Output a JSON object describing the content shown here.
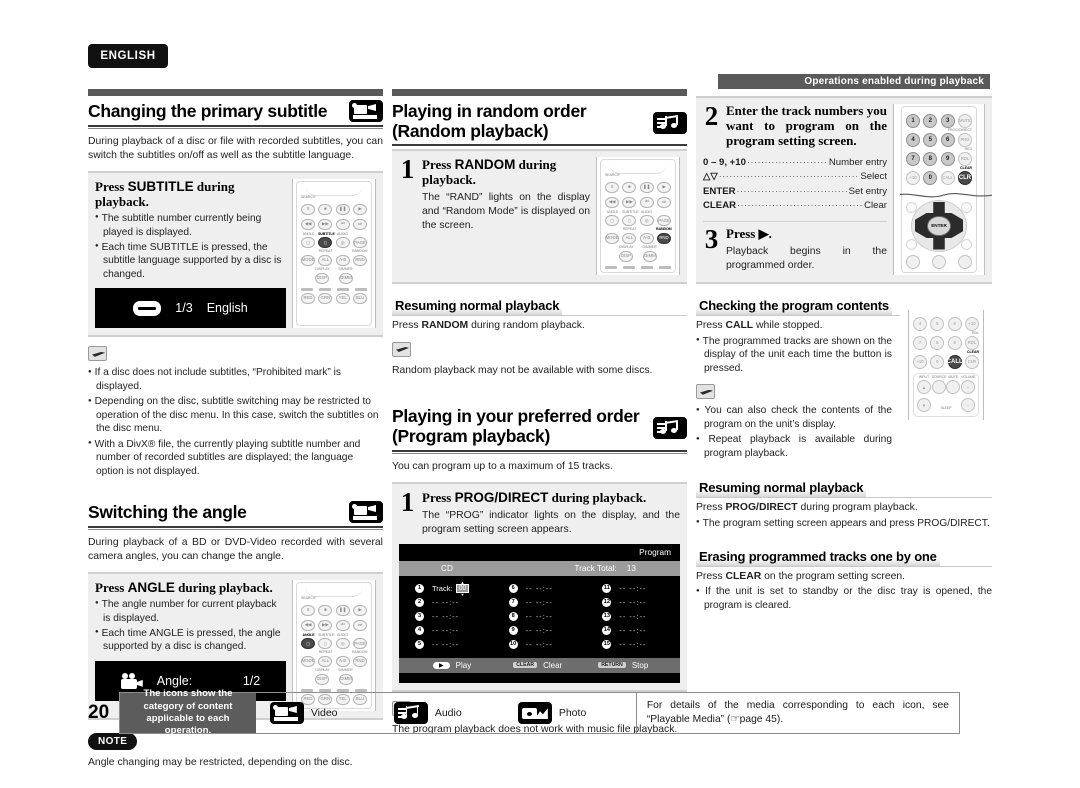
{
  "language_tab": "ENGLISH",
  "running_header": "Operations enabled during playback",
  "page_number": "20",
  "col_a": {
    "section1": {
      "title": "Changing the primary subtitle",
      "icon": "video-icon",
      "intro": "During playback of a disc or file with recorded subtitles, you can switch the subtitles on/off as well as the subtitle language.",
      "proc_head_pre": "Press ",
      "proc_head_key": "SUBTITLE",
      "proc_head_post": " during playback.",
      "bullets": [
        "The subtitle number currently being played is displayed.",
        "Each time SUBTITLE is pressed, the subtitle language supported by a disc is changed."
      ],
      "osd": {
        "icon": "subtitle-icon",
        "value": "1/3",
        "label": "English"
      },
      "memo_bullets": [
        "If a disc does not include subtitles, “Prohibited mark” is displayed.",
        "Depending on the disc, subtitle switching may be restricted to operation of the disc menu. In this case, switch the subtitles on the disc menu.",
        "With a DivX® file, the currently playing subtitle number and number of recorded subtitles are displayed; the language option is not displayed."
      ]
    },
    "section2": {
      "title": "Switching the angle",
      "icon": "video-icon",
      "intro": "During playback of a BD or DVD-Video recorded with several camera angles, you can change the angle.",
      "proc_head_pre": "Press ",
      "proc_head_key": "ANGLE",
      "proc_head_post": " during playback.",
      "bullets": [
        "The angle number for current playback is displayed.",
        "Each time ANGLE is pressed, the angle supported by a disc is changed."
      ],
      "osd": {
        "icon": "camera-icon",
        "label": "Angle:",
        "value": "1/2"
      },
      "note_badge": "NOTE",
      "note_text": "Angle changing may be restricted, depending on the disc."
    }
  },
  "col_b": {
    "section1": {
      "title_line1": "Playing in random order",
      "title_line2": "(Random playback)",
      "icon": "audio-icon",
      "step_number": "1",
      "proc_head_pre": "Press ",
      "proc_head_key": "RANDOM",
      "proc_head_post": " during playback.",
      "proc_body": "The “RAND” lights on the display and “Random Mode” is displayed on the screen.",
      "subhead": "Resuming normal playback",
      "sub_text_pre": "Press ",
      "sub_text_key": "RANDOM",
      "sub_text_post": " during random playback.",
      "memo_text": "Random playback may not be available with some discs."
    },
    "section2": {
      "title_line1": "Playing in your preferred order",
      "title_line2": "(Program playback)",
      "icon": "audio-icon",
      "intro": "You can program up to a maximum of 15 tracks.",
      "step_number": "1",
      "proc_head_pre": "Press ",
      "proc_head_key": "PROG/DIRECT",
      "proc_head_post": " during playback.",
      "proc_body": "The “PROG” indicator lights on the display, and the program setting screen appears.",
      "memo_text": "The program playback does not work with music file playback."
    },
    "program_screen": {
      "title": "Program",
      "disc_label": "CD",
      "track_total_label": "Track Total:",
      "track_total_value": "13",
      "track_label": "Track:",
      "track_value": "00",
      "empty_value": "-- --:--",
      "slots": [
        "1",
        "2",
        "3",
        "4",
        "5",
        "6",
        "7",
        "8",
        "9",
        "10",
        "11",
        "12",
        "13",
        "14",
        "15"
      ],
      "footer": [
        {
          "badge": "▶",
          "label": "Play",
          "style": "pill"
        },
        {
          "badge": "CLEAR",
          "label": "Clear",
          "style": "tag"
        },
        {
          "badge": "RETURN",
          "label": "Stop",
          "style": "tag"
        }
      ]
    }
  },
  "col_c": {
    "step2": {
      "number": "2",
      "head": "Enter the track numbers you want to program on the program setting screen.",
      "keys": [
        {
          "key": "0 – 9, +10",
          "value": "Number entry"
        },
        {
          "key": "△▽",
          "value": "Select"
        },
        {
          "key": "ENTER",
          "value": "Set entry"
        },
        {
          "key": "CLEAR",
          "value": "Clear"
        }
      ]
    },
    "step3": {
      "number": "3",
      "head": "Press ▶.",
      "body": "Playback begins in the programmed order."
    },
    "section_check": {
      "subhead": "Checking the program contents",
      "line_pre": "Press ",
      "line_key": "CALL",
      "line_post": " while stopped.",
      "bullets": [
        "The programmed tracks are shown on the display of the unit each time the button is pressed."
      ],
      "memo_bullets": [
        "You can also check the contents of the program on the unit’s display.",
        "Repeat playback is available during program playback."
      ]
    },
    "section_resume": {
      "subhead": "Resuming normal playback",
      "line_pre": "Press ",
      "line_key": "PROG/DIRECT",
      "line_post": " during program playback.",
      "bullets": [
        "The program setting screen appears and press PROG/DIRECT."
      ]
    },
    "section_erase": {
      "subhead": "Erasing programmed tracks one by one",
      "line_pre": "Press ",
      "line_key": "CLEAR",
      "line_post": " on the program setting screen.",
      "bullets": [
        "If the unit is set to standby or the disc tray is opened, the program is cleared."
      ]
    }
  },
  "footer": {
    "category_text": "The icons show the category of content applicable to each operation.",
    "icons": [
      {
        "name": "video-icon",
        "label": "Video"
      },
      {
        "name": "audio-icon",
        "label": "Audio"
      },
      {
        "name": "photo-icon",
        "label": "Photo"
      }
    ],
    "details_text": "For details of the media corresponding to each icon, see “Playable Media” (☞page 45)."
  },
  "remote_keys": {
    "row_search": [
      "S",
      "■",
      "‖",
      "▶"
    ],
    "row_skip": [
      "◀◀",
      "▶▶",
      "❘◀◀",
      "▶▶❘"
    ],
    "row_func_labels": [
      "ANGLE",
      "SUBTITLE",
      "AUDIO",
      ""
    ],
    "row_func": [
      "⬛",
      "▭",
      "◎",
      "PAGE"
    ],
    "row_mode": [
      "MODE",
      "ALL",
      "A-B",
      "RND"
    ],
    "row_mode_labels": [
      "",
      "REPEAT",
      "",
      "RANDOM"
    ],
    "row_disp": [
      "DISP",
      "DIMM"
    ],
    "row_disp_labels": [
      "DISPLAY",
      "DIMMER"
    ],
    "row_color": [
      "RED",
      "GRN",
      "YEL",
      "BLU"
    ],
    "numpad": [
      [
        "1",
        "2",
        "3",
        "MUTE"
      ],
      [
        "4",
        "5",
        "6",
        "PRG"
      ],
      [
        "7",
        "8",
        "9",
        "RDL"
      ],
      [
        "+10",
        "0",
        "CALL",
        "CLR"
      ]
    ],
    "numpad_caps": [
      "MUTE",
      "PROG/DIRECT",
      "RED",
      "CLEAR"
    ],
    "enter_label": "ENTER",
    "numpad2": [
      [
        "4",
        "5",
        "6",
        "(+10)"
      ],
      [
        "7",
        "8",
        "9",
        "(4O.)"
      ],
      [
        "+10",
        "0",
        "CALL",
        "CLR"
      ]
    ],
    "numpad2_caps": [
      "RDL",
      "CLEAR"
    ],
    "bottom_labels": [
      "INPUT",
      "SOURCE",
      "MUTE",
      "VOLUME"
    ],
    "slp_label": "SLEEP"
  }
}
